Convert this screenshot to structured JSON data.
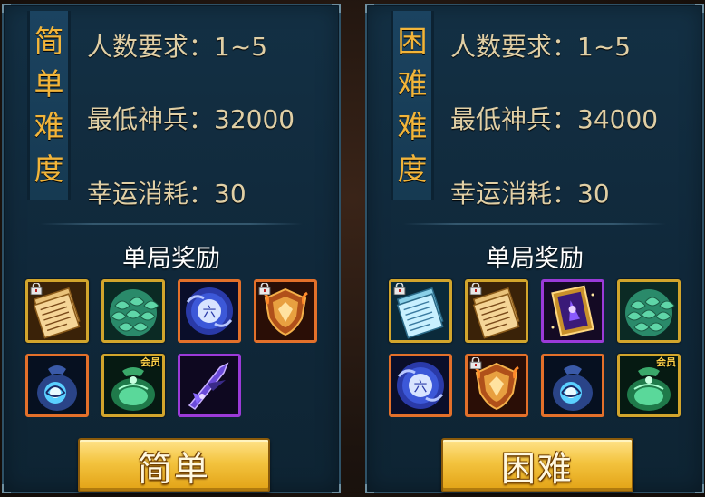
{
  "panels": [
    {
      "difficulty_chars": [
        "简",
        "单",
        "难",
        "度"
      ],
      "players_label": "人数要求：",
      "players_value": "1~5",
      "min_weapon_label": "最低神兵：",
      "min_weapon_value": "32000",
      "luck_cost_label": "幸运消耗：",
      "luck_cost_value": "30",
      "reward_title": "单局奖励",
      "rewards": [
        {
          "icon": "scroll-icon",
          "rarity": "gold",
          "locked": true,
          "vip": ""
        },
        {
          "icon": "dragon-scale-icon",
          "rarity": "gold",
          "locked": false,
          "vip": ""
        },
        {
          "icon": "rune-orb-icon",
          "rarity": "orange",
          "locked": false,
          "vip": ""
        },
        {
          "icon": "flame-shield-icon",
          "rarity": "orange",
          "locked": true,
          "vip": ""
        },
        {
          "icon": "soul-pouch-icon",
          "rarity": "orange",
          "locked": false,
          "vip": ""
        },
        {
          "icon": "jade-pouch-icon",
          "rarity": "gold",
          "locked": false,
          "vip": "会员"
        },
        {
          "icon": "shadow-blade-icon",
          "rarity": "purple",
          "locked": false,
          "vip": ""
        }
      ],
      "button_label": "简单"
    },
    {
      "difficulty_chars": [
        "困",
        "难",
        "难",
        "度"
      ],
      "players_label": "人数要求：",
      "players_value": "1~5",
      "min_weapon_label": "最低神兵：",
      "min_weapon_value": "34000",
      "luck_cost_label": "幸运消耗：",
      "luck_cost_value": "30",
      "reward_title": "单局奖励",
      "rewards": [
        {
          "icon": "blue-scroll-icon",
          "rarity": "gold",
          "locked": true,
          "vip": ""
        },
        {
          "icon": "scroll-icon",
          "rarity": "gold",
          "locked": true,
          "vip": ""
        },
        {
          "icon": "purple-card-icon",
          "rarity": "purple",
          "locked": false,
          "vip": ""
        },
        {
          "icon": "dragon-scale-icon",
          "rarity": "gold",
          "locked": false,
          "vip": ""
        },
        {
          "icon": "rune-orb-icon",
          "rarity": "orange",
          "locked": false,
          "vip": ""
        },
        {
          "icon": "flame-shield-icon",
          "rarity": "orange",
          "locked": true,
          "vip": ""
        },
        {
          "icon": "soul-pouch-icon",
          "rarity": "orange",
          "locked": false,
          "vip": ""
        },
        {
          "icon": "jade-pouch-icon",
          "rarity": "gold",
          "locked": false,
          "vip": "会员"
        }
      ],
      "button_label": "困难"
    }
  ],
  "colors": {
    "tag_text": "#f2b53a",
    "info_text": "#e0cfa5",
    "gold_frame": "#d2a52c",
    "purple_frame": "#9b3ad8",
    "orange_frame": "#e3702a"
  }
}
